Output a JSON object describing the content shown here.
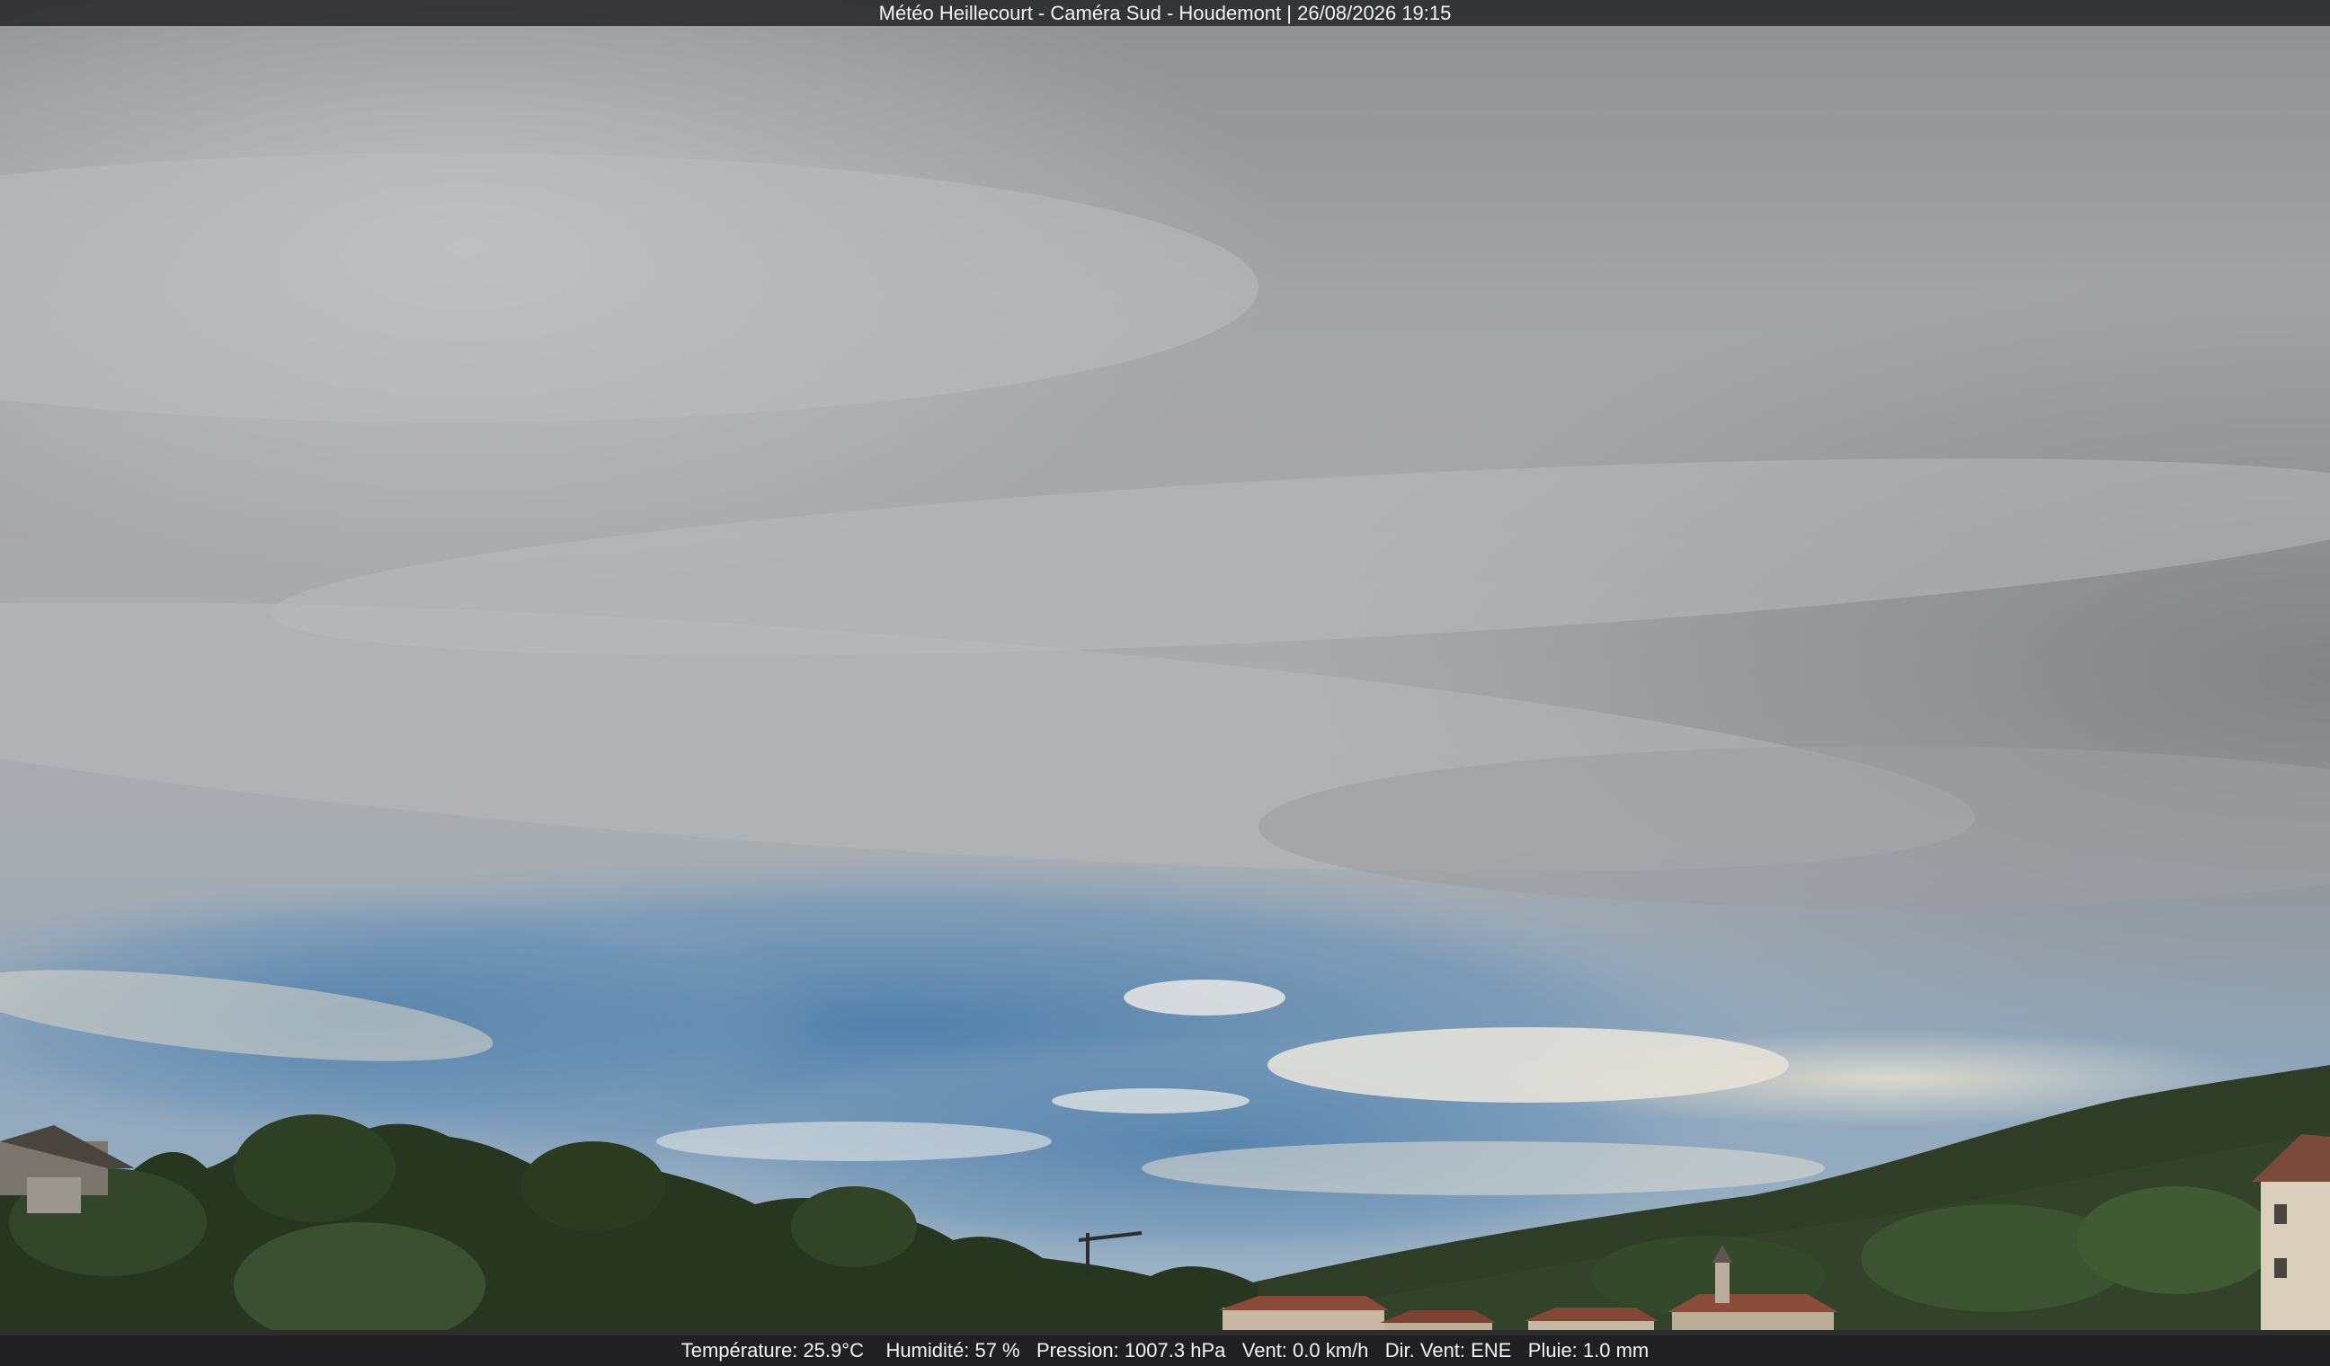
{
  "overlay": {
    "title": "Météo Heillecourt - Caméra Sud - Houdemont | 26/08/2026 19:15",
    "weather": {
      "temperature": "Température: 25.9°C",
      "humidity": "Humidité: 57 %",
      "pressure": "Pression: 1007.3 hPa",
      "wind": "Vent: 0.0 km/h",
      "wind_direction": "Dir. Vent: ENE",
      "rain": "Pluie: 1.0 mm"
    }
  },
  "scene": {
    "sky_top": "#9fa0a3",
    "sky_mid": "#b8b9bb",
    "sky_blue": "#5f89b0",
    "hill_color": "#2c3a22",
    "tree_color": "#263420",
    "roof_color": "#8a4a38"
  }
}
